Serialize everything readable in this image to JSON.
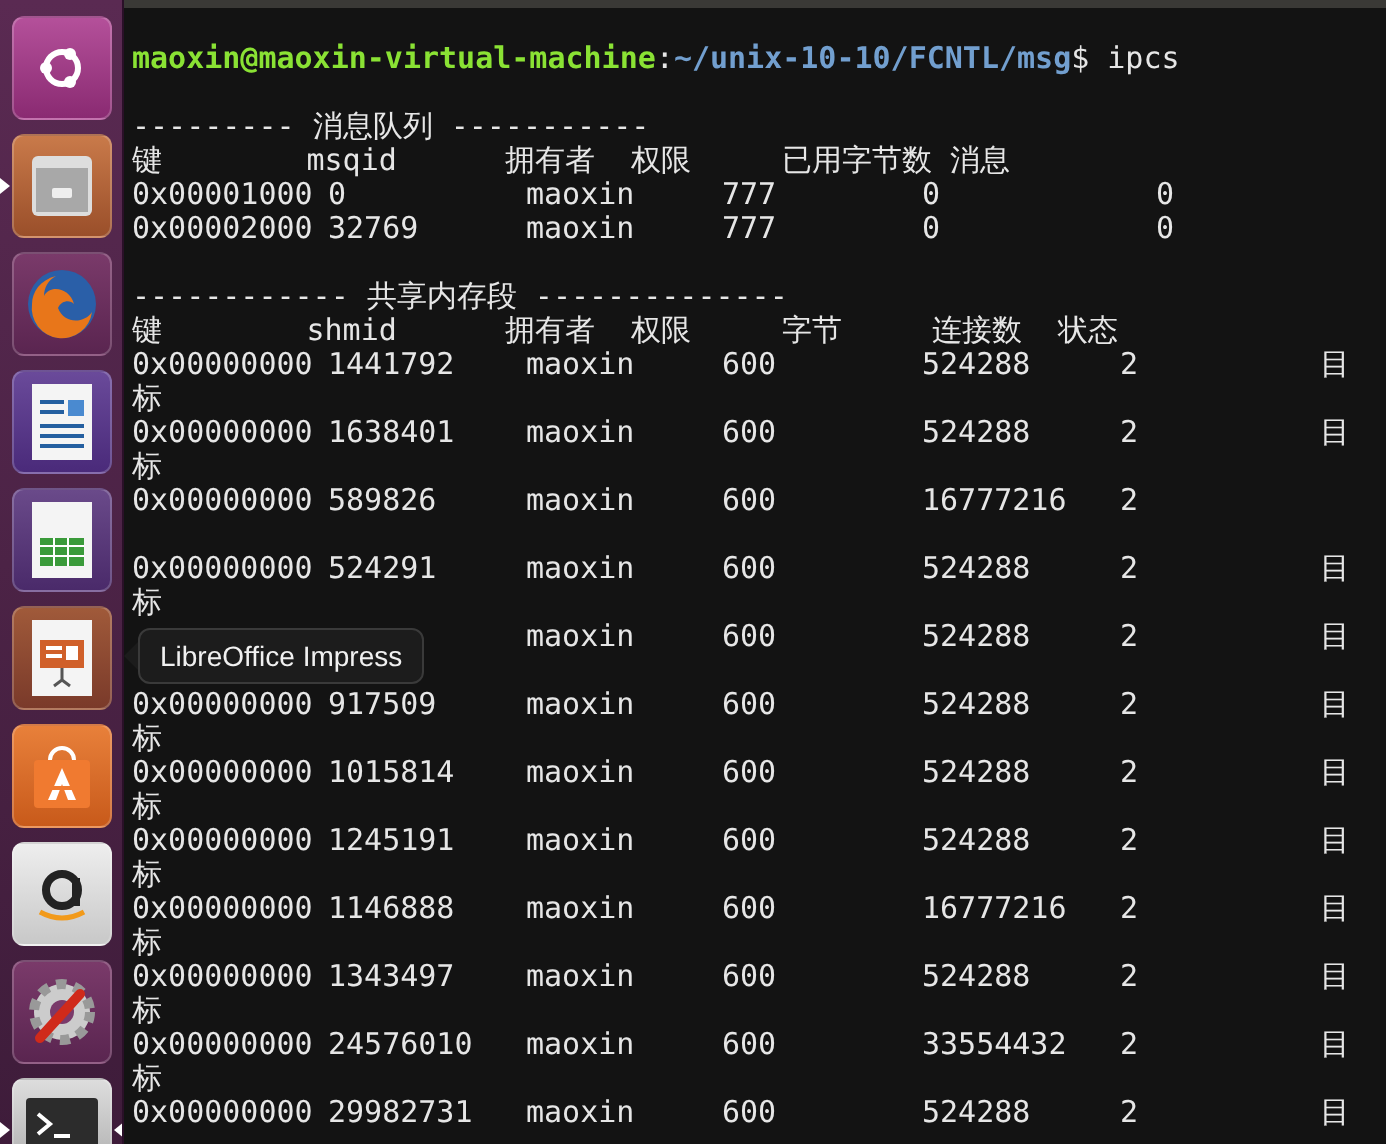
{
  "launcher": [
    {
      "kind": "ubuntu",
      "running": false,
      "focused": false
    },
    {
      "kind": "files",
      "running": true,
      "focused": false
    },
    {
      "kind": "firefox",
      "running": false,
      "focused": false
    },
    {
      "kind": "writer",
      "running": false,
      "focused": false
    },
    {
      "kind": "calc",
      "running": false,
      "focused": false
    },
    {
      "kind": "impress",
      "running": false,
      "focused": false
    },
    {
      "kind": "software",
      "running": false,
      "focused": false
    },
    {
      "kind": "amazon",
      "running": false,
      "focused": false
    },
    {
      "kind": "settings",
      "running": false,
      "focused": false
    },
    {
      "kind": "terminal",
      "running": true,
      "focused": true
    }
  ],
  "tooltip": {
    "text": "LibreOffice Impress"
  },
  "terminal": {
    "prompt": {
      "user_host": "maoxin@maoxin-virtual-machine",
      "separator": ":",
      "path": "~/unix-10-10/FCNTL/msg",
      "symbol": "$",
      "command": "ipcs"
    },
    "sections": [
      {
        "kind": "msg",
        "title": "--------- 消息队列 -----------",
        "header_line": "键        msqid      拥有者  权限     已用字节数 消息",
        "rows": [
          {
            "cells": [
              "0x00001000",
              "0",
              "maoxin",
              "777",
              "0",
              "0"
            ]
          },
          {
            "cells": [
              "0x00002000",
              "32769",
              "maoxin",
              "777",
              "0",
              "0"
            ]
          }
        ]
      },
      {
        "kind": "shm",
        "title": "------------ 共享内存段 --------------",
        "header_line": "键        shmid      拥有者  权限     字节     连接数  状态",
        "rows": [
          {
            "cells": [
              "0x00000000",
              "1441792",
              "maoxin",
              "600",
              "524288",
              "2",
              "目"
            ],
            "continuation": {
              "kind": "wrap",
              "text": "标"
            }
          },
          {
            "cells": [
              "0x00000000",
              "1638401",
              "maoxin",
              "600",
              "524288",
              "2",
              "目"
            ],
            "continuation": {
              "kind": "wrap",
              "text": "标"
            }
          },
          {
            "cells": [
              "0x00000000",
              "589826",
              "maoxin",
              "600",
              "16777216",
              "2"
            ],
            "continuation": {
              "kind": "blank"
            }
          },
          {
            "cells": [
              "0x00000000",
              "524291",
              "maoxin",
              "600",
              "524288",
              "2",
              "目"
            ],
            "continuation": {
              "kind": "wrap",
              "text": "标"
            }
          },
          {
            "cells": [
              null,
              null,
              "maoxin",
              "600",
              "524288",
              "2",
              "目"
            ],
            "continuation": {
              "kind": "blank"
            }
          },
          {
            "cells": [
              "0x00000000",
              "917509",
              "maoxin",
              "600",
              "524288",
              "2",
              "目"
            ],
            "continuation": {
              "kind": "wrap",
              "text": "标"
            }
          },
          {
            "cells": [
              "0x00000000",
              "1015814",
              "maoxin",
              "600",
              "524288",
              "2",
              "目"
            ],
            "continuation": {
              "kind": "wrap",
              "text": "标"
            }
          },
          {
            "cells": [
              "0x00000000",
              "1245191",
              "maoxin",
              "600",
              "524288",
              "2",
              "目"
            ],
            "continuation": {
              "kind": "wrap",
              "text": "标"
            }
          },
          {
            "cells": [
              "0x00000000",
              "1146888",
              "maoxin",
              "600",
              "16777216",
              "2",
              "目"
            ],
            "continuation": {
              "kind": "wrap",
              "text": "标"
            }
          },
          {
            "cells": [
              "0x00000000",
              "1343497",
              "maoxin",
              "600",
              "524288",
              "2",
              "目"
            ],
            "continuation": {
              "kind": "wrap",
              "text": "标"
            }
          },
          {
            "cells": [
              "0x00000000",
              "24576010",
              "maoxin",
              "600",
              "33554432",
              "2",
              "目"
            ],
            "continuation": {
              "kind": "wrap",
              "text": "标"
            }
          },
          {
            "cells": [
              "0x00000000",
              "29982731",
              "maoxin",
              "600",
              "524288",
              "2",
              "目"
            ]
          }
        ]
      }
    ]
  }
}
